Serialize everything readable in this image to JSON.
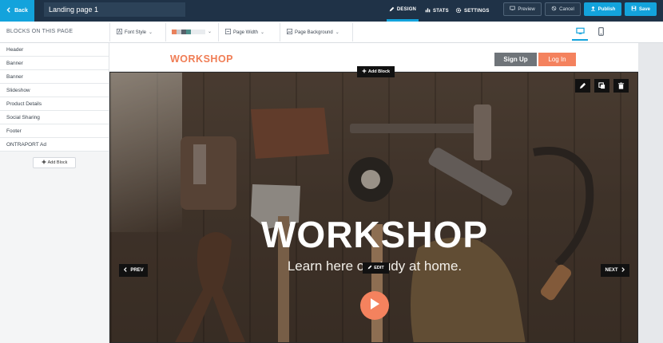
{
  "topbar": {
    "back_label": "Back",
    "page_name": "Landing page 1",
    "tabs": [
      {
        "label": "DESIGN",
        "icon": "pencil-icon"
      },
      {
        "label": "STATS",
        "icon": "bar-chart-icon"
      },
      {
        "label": "SETTINGS",
        "icon": "gear-icon"
      }
    ],
    "preview_label": "Preview",
    "cancel_label": "Cancel",
    "publish_label": "Publish",
    "save_label": "Save"
  },
  "toolbar": {
    "blocks_title": "BLOCKS ON THIS PAGE",
    "font_style_label": "Font Style",
    "page_width_label": "Page Width",
    "page_background_label": "Page Background",
    "palette": [
      "#e9815c",
      "#c9cdd1",
      "#57606a",
      "#4c8f8a"
    ]
  },
  "sidebar": {
    "items": [
      {
        "label": "Header"
      },
      {
        "label": "Banner"
      },
      {
        "label": "Banner"
      },
      {
        "label": "Slideshow"
      },
      {
        "label": "Product Details"
      },
      {
        "label": "Social Sharing"
      },
      {
        "label": "Footer"
      },
      {
        "label": "ONTRAPORT Ad"
      }
    ],
    "add_block_label": "Add Block"
  },
  "canvas": {
    "logo": "WORKSHOP",
    "signup_label": "Sign Up",
    "login_label": "Log In",
    "add_block_label": "Add Block",
    "hero_title": "WORKSHOP",
    "hero_subtitle": "Learn here or study at home.",
    "edit_label": "EDIT",
    "prev_label": "PREV",
    "next_label": "NEXT"
  },
  "colors": {
    "accent": "#13a3dc",
    "brand": "#f4825e",
    "topbar": "#1f3247"
  }
}
